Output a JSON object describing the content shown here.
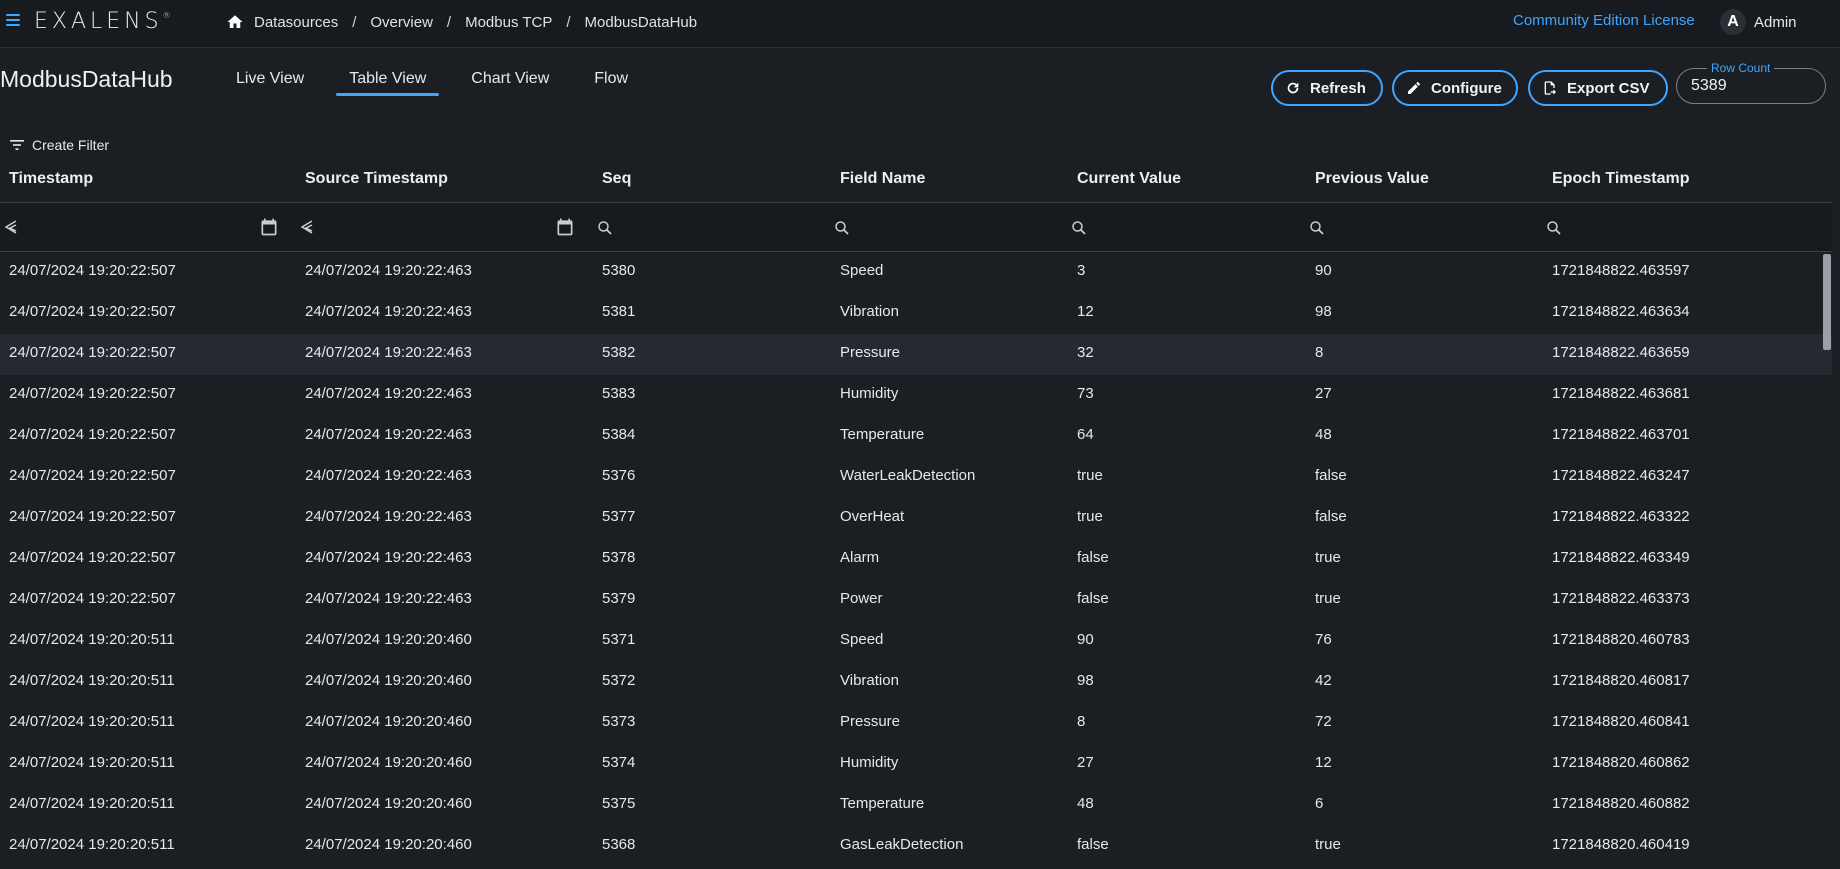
{
  "app": {
    "logo_text": "EXALENS",
    "logo_mark": "®"
  },
  "breadcrumb": [
    "Datasources",
    "Overview",
    "Modbus TCP",
    "ModbusDataHub"
  ],
  "breadcrumb_sep": "/",
  "header": {
    "license_link": "Community Edition License",
    "user_initial": "A",
    "user_name": "Admin"
  },
  "page": {
    "title": "ModbusDataHub",
    "tabs": [
      {
        "label": "Live View",
        "active": false
      },
      {
        "label": "Table View",
        "active": true
      },
      {
        "label": "Chart View",
        "active": false
      },
      {
        "label": "Flow",
        "active": false
      }
    ]
  },
  "actions": {
    "refresh": "Refresh",
    "configure": "Configure",
    "export": "Export CSV"
  },
  "row_count": {
    "label": "Row Count",
    "value": "5389"
  },
  "filter": {
    "create_label": "Create Filter"
  },
  "colors": {
    "accent": "#3ea6ff",
    "background": "#1b1f24",
    "row_highlight": "#262a30"
  },
  "table": {
    "columns": [
      "Timestamp",
      "Source Timestamp",
      "Seq",
      "Field Name",
      "Current Value",
      "Previous Value",
      "Epoch Timestamp"
    ],
    "filter_icons": [
      "date-range-icon",
      "date-range-icon",
      "search-icon",
      "search-icon",
      "search-icon",
      "search-icon",
      "search-icon"
    ],
    "rows": [
      [
        "24/07/2024 19:20:22:507",
        "24/07/2024 19:20:22:463",
        "5380",
        "Speed",
        "3",
        "90",
        "1721848822.463597"
      ],
      [
        "24/07/2024 19:20:22:507",
        "24/07/2024 19:20:22:463",
        "5381",
        "Vibration",
        "12",
        "98",
        "1721848822.463634"
      ],
      [
        "24/07/2024 19:20:22:507",
        "24/07/2024 19:20:22:463",
        "5382",
        "Pressure",
        "32",
        "8",
        "1721848822.463659"
      ],
      [
        "24/07/2024 19:20:22:507",
        "24/07/2024 19:20:22:463",
        "5383",
        "Humidity",
        "73",
        "27",
        "1721848822.463681"
      ],
      [
        "24/07/2024 19:20:22:507",
        "24/07/2024 19:20:22:463",
        "5384",
        "Temperature",
        "64",
        "48",
        "1721848822.463701"
      ],
      [
        "24/07/2024 19:20:22:507",
        "24/07/2024 19:20:22:463",
        "5376",
        "WaterLeakDetection",
        "true",
        "false",
        "1721848822.463247"
      ],
      [
        "24/07/2024 19:20:22:507",
        "24/07/2024 19:20:22:463",
        "5377",
        "OverHeat",
        "true",
        "false",
        "1721848822.463322"
      ],
      [
        "24/07/2024 19:20:22:507",
        "24/07/2024 19:20:22:463",
        "5378",
        "Alarm",
        "false",
        "true",
        "1721848822.463349"
      ],
      [
        "24/07/2024 19:20:22:507",
        "24/07/2024 19:20:22:463",
        "5379",
        "Power",
        "false",
        "true",
        "1721848822.463373"
      ],
      [
        "24/07/2024 19:20:20:511",
        "24/07/2024 19:20:20:460",
        "5371",
        "Speed",
        "90",
        "76",
        "1721848820.460783"
      ],
      [
        "24/07/2024 19:20:20:511",
        "24/07/2024 19:20:20:460",
        "5372",
        "Vibration",
        "98",
        "42",
        "1721848820.460817"
      ],
      [
        "24/07/2024 19:20:20:511",
        "24/07/2024 19:20:20:460",
        "5373",
        "Pressure",
        "8",
        "72",
        "1721848820.460841"
      ],
      [
        "24/07/2024 19:20:20:511",
        "24/07/2024 19:20:20:460",
        "5374",
        "Humidity",
        "27",
        "12",
        "1721848820.460862"
      ],
      [
        "24/07/2024 19:20:20:511",
        "24/07/2024 19:20:20:460",
        "5375",
        "Temperature",
        "48",
        "6",
        "1721848820.460882"
      ],
      [
        "24/07/2024 19:20:20:511",
        "24/07/2024 19:20:20:460",
        "5368",
        "GasLeakDetection",
        "false",
        "true",
        "1721848820.460419"
      ]
    ],
    "highlighted_row": 2
  }
}
